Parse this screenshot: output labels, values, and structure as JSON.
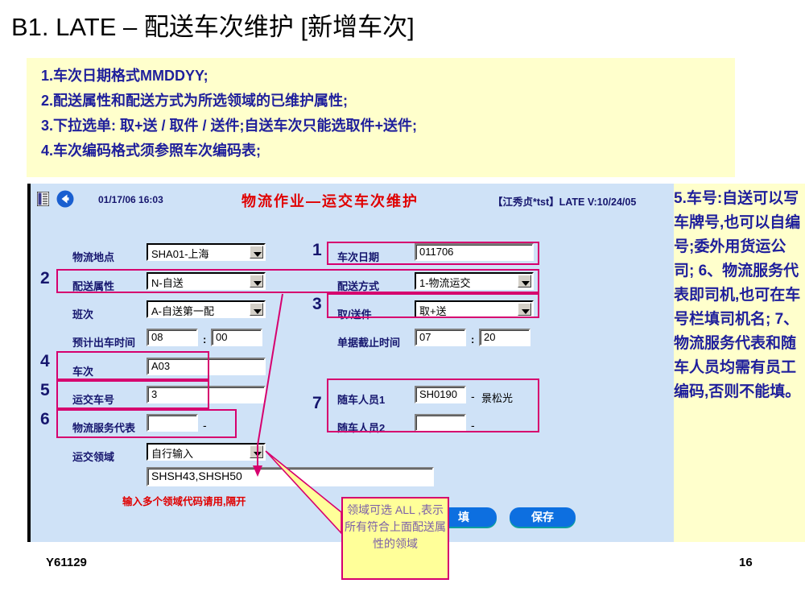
{
  "slide": {
    "title": "B1. LATE – 配送车次维护 [新增车次]",
    "footer_code": "Y61129",
    "page_number": "16"
  },
  "notes": {
    "lines": [
      "1.车次日期格式MMDDYY;",
      "2.配送属性和配送方式为所选领域的已维护属性;",
      "3.下拉选单: 取+送 / 取件 / 送件;自送车次只能选取件+送件;",
      "4.车次编码格式须参照车次编码表;"
    ]
  },
  "right_panel": {
    "text": "5.车号:自送可以写车牌号,也可以自编号;委外用货运公司;\n6、物流服务代表即司机,也可在车号栏填司机名;\n7、物流服务代表和随车人员均需有员工编码,否则不能填。"
  },
  "app": {
    "datetime": "01/17/06 16:03",
    "title": "物流作业—运交车次维护",
    "version": "【江秀贞*tst】LATE V:10/24/05",
    "icons": {
      "document": "document-icon",
      "back": "back-arrow-icon"
    }
  },
  "form": {
    "location": {
      "label": "物流地点",
      "value": "SHA01-上海"
    },
    "delivery_attr": {
      "label": "配送属性",
      "value": "N-自送"
    },
    "shift": {
      "label": "班次",
      "value": "A-自送第一配"
    },
    "depart_time": {
      "label": "预计出车时间",
      "hour": "08",
      "minute": "00"
    },
    "trip_no": {
      "label": "车次",
      "value": "A03"
    },
    "vehicle_no": {
      "label": "运交车号",
      "value": "3"
    },
    "service_rep": {
      "label": "物流服务代表",
      "value": "",
      "suffix": "-"
    },
    "domain": {
      "label": "运交领域",
      "value": "自行输入",
      "codes": "SHSH43,SHSH50"
    },
    "trip_date": {
      "label": "车次日期",
      "value": "011706"
    },
    "delivery_mode": {
      "label": "配送方式",
      "value": "1-物流运交"
    },
    "pick_deliver": {
      "label": "取/送件",
      "value": "取+送"
    },
    "cutoff_time": {
      "label": "单据截止时间",
      "hour": "07",
      "minute": "20"
    },
    "crew1": {
      "label": "随车人员1",
      "value": "SH0190",
      "dash": "-",
      "name": "景松光"
    },
    "crew2": {
      "label": "随车人员2",
      "value": "",
      "dash": "-",
      "name": ""
    },
    "hint_domain": "输入多个领域代码请用,隔开"
  },
  "buttons": [
    {
      "label": "填",
      "name": "fill-button"
    },
    {
      "label": "保存",
      "name": "save-button"
    }
  ],
  "callouts": {
    "numbers": [
      "1",
      "2",
      "3",
      "4",
      "5",
      "6",
      "7"
    ],
    "domain_note": "领域可选 ALL ,表示所有符合上面配送属性的领域"
  },
  "colors": {
    "accent_pink": "#d6006e",
    "app_bg": "#cfe2f7",
    "note_bg": "#ffffcc",
    "note_text": "#1f1f9c",
    "app_title": "#e00000",
    "button": "#0d6fe0"
  }
}
